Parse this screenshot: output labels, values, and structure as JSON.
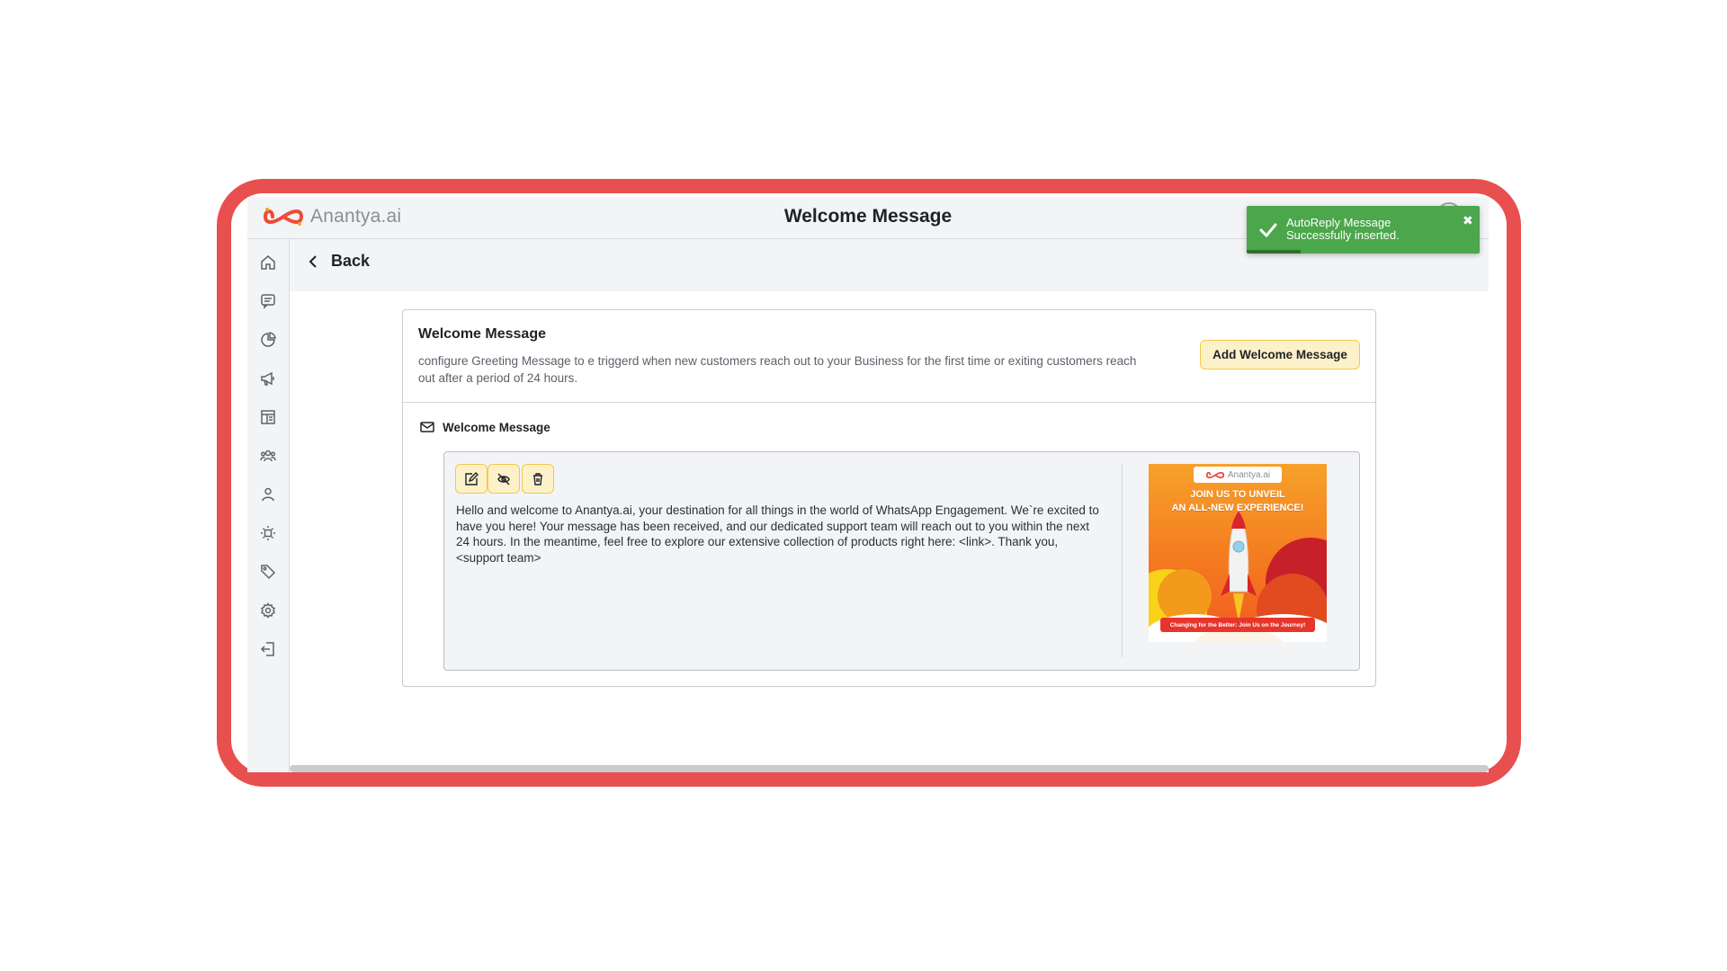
{
  "brand": {
    "name": "Anantya.ai",
    "accent_color": "#e84f4f"
  },
  "header": {
    "title": "Welcome Message"
  },
  "navigation": {
    "back_label": "Back"
  },
  "sidebar": {
    "items": [
      {
        "icon": "home-icon"
      },
      {
        "icon": "chat-icon"
      },
      {
        "icon": "analytics-icon"
      },
      {
        "icon": "megaphone-icon"
      },
      {
        "icon": "templates-icon"
      },
      {
        "icon": "contacts-group-icon"
      },
      {
        "icon": "user-icon"
      },
      {
        "icon": "integrations-icon"
      },
      {
        "icon": "tag-icon"
      },
      {
        "icon": "settings-icon"
      },
      {
        "icon": "logout-icon"
      }
    ]
  },
  "card": {
    "title": "Welcome Message",
    "description": "configure Greeting Message to e triggerd when new customers reach out to your Business for the first time or exiting customers reach out after a period of 24 hours.",
    "add_button_label": "Add Welcome Message",
    "section_label": "Welcome Message",
    "message": {
      "text": "Hello and welcome to Anantya.ai, your destination for all things in the world of WhatsApp Engagement. We`re excited to have you here! Your message has been received, and our dedicated support team will reach out to you within the next 24 hours. In the meantime, feel free to explore our extensive collection of products right here: <link>. Thank you, <support team>",
      "tools": [
        "edit-icon",
        "disable-icon",
        "delete-icon"
      ],
      "image": {
        "logo_text": "Anantya.ai",
        "headline_line1": "JOIN US TO UNVEIL",
        "headline_line2": "AN ALL-NEW EXPERIENCE!",
        "banner": "Changing for the Better: Join Us on the Journey!"
      }
    }
  },
  "toast": {
    "message": "AutoReply Message Successfully inserted.",
    "close_symbol": "✖",
    "color": "#4ca64c",
    "progress": 0.23
  }
}
